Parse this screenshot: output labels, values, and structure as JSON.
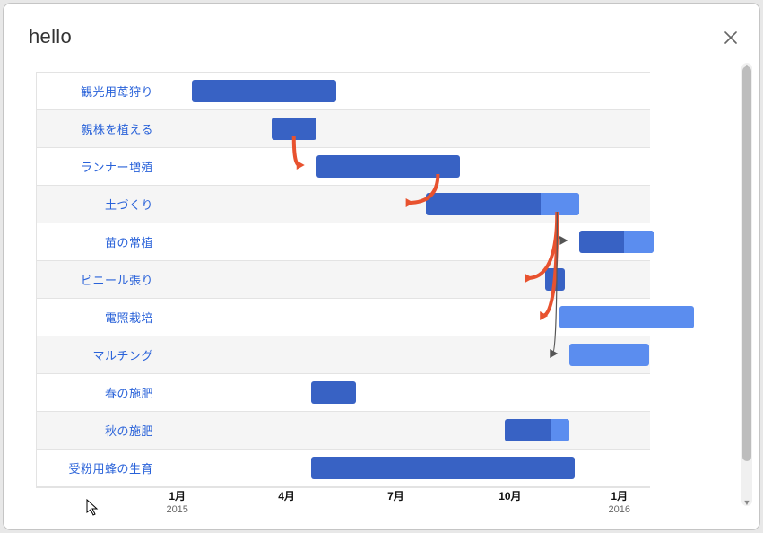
{
  "header": {
    "title": "hello"
  },
  "chart_data": {
    "type": "bar",
    "title": "",
    "xlabel": "",
    "ylabel": "",
    "time_axis": {
      "start": "2015-01",
      "end": "2016-04",
      "major_ticks": [
        {
          "pos_pct": 5,
          "label": "1月",
          "sub": "2015"
        },
        {
          "pos_pct": 27,
          "label": "4月",
          "sub": ""
        },
        {
          "pos_pct": 49,
          "label": "7月",
          "sub": ""
        },
        {
          "pos_pct": 72,
          "label": "10月",
          "sub": ""
        },
        {
          "pos_pct": 94,
          "label": "1月",
          "sub": "2016"
        }
      ]
    },
    "tasks": [
      {
        "name": "観光用苺狩り",
        "start_pct": 6,
        "dur_pct": 29,
        "done_pct": 100,
        "light": false
      },
      {
        "name": "親株を植える",
        "start_pct": 22,
        "dur_pct": 9,
        "done_pct": 100,
        "light": false
      },
      {
        "name": "ランナー増殖",
        "start_pct": 31,
        "dur_pct": 29,
        "done_pct": 100,
        "light": false
      },
      {
        "name": "土づくり",
        "start_pct": 53,
        "dur_pct": 31,
        "done_pct": 75,
        "light": false
      },
      {
        "name": "苗の常植",
        "start_pct": 84,
        "dur_pct": 15,
        "done_pct": 60,
        "light": false
      },
      {
        "name": "ビニール張り",
        "start_pct": 77,
        "dur_pct": 4,
        "done_pct": 100,
        "light": false
      },
      {
        "name": "電照栽培",
        "start_pct": 80,
        "dur_pct": 27,
        "done_pct": 0,
        "light": true
      },
      {
        "name": "マルチング",
        "start_pct": 82,
        "dur_pct": 16,
        "done_pct": 0,
        "light": true
      },
      {
        "name": "春の施肥",
        "start_pct": 30,
        "dur_pct": 9,
        "done_pct": 100,
        "light": false
      },
      {
        "name": "秋の施肥",
        "start_pct": 69,
        "dur_pct": 13,
        "done_pct": 70,
        "light": false
      },
      {
        "name": "受粉用蜂の生育",
        "start_pct": 30,
        "dur_pct": 53,
        "done_pct": 100,
        "light": false
      }
    ],
    "dependencies": [
      {
        "from": 1,
        "to": 2,
        "critical": true
      },
      {
        "from": 2,
        "to": 3,
        "critical": true
      },
      {
        "from": 3,
        "to": 4,
        "critical": false
      },
      {
        "from": 3,
        "to": 5,
        "critical": true
      },
      {
        "from": 3,
        "to": 6,
        "critical": true
      },
      {
        "from": 3,
        "to": 7,
        "critical": false
      }
    ]
  }
}
